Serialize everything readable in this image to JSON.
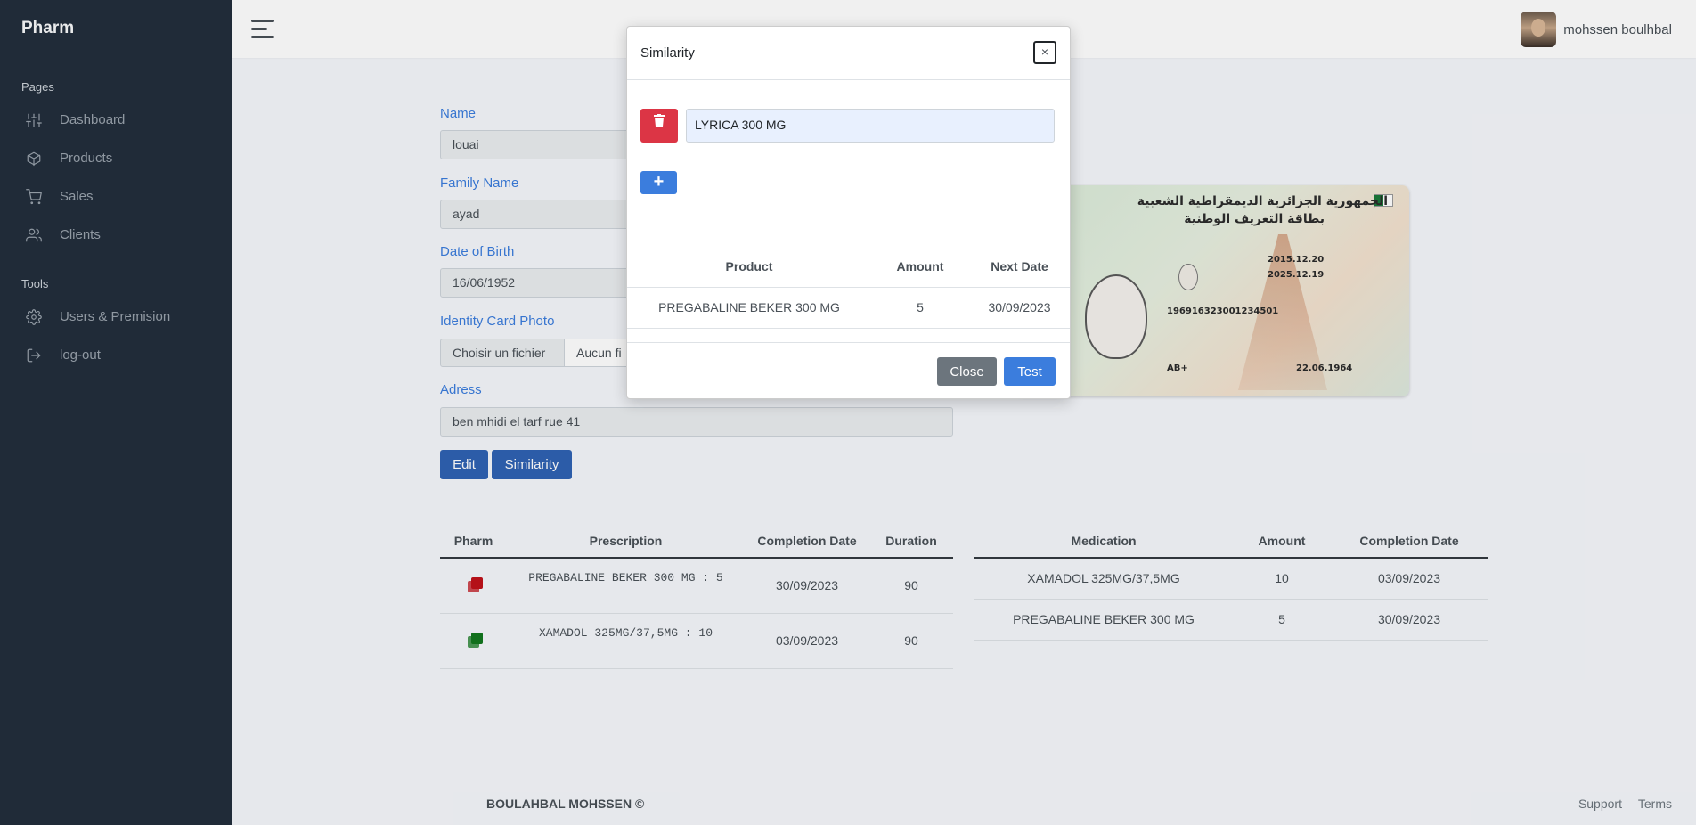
{
  "app": {
    "brand": "Pharm"
  },
  "sidebar": {
    "sections": [
      {
        "header": "Pages",
        "items": [
          {
            "label": "Dashboard",
            "icon": "sliders-icon"
          },
          {
            "label": "Products",
            "icon": "package-icon"
          },
          {
            "label": "Sales",
            "icon": "cart-icon"
          },
          {
            "label": "Clients",
            "icon": "users-icon"
          }
        ]
      },
      {
        "header": "Tools",
        "items": [
          {
            "label": "Users & Premision",
            "icon": "gear-icon"
          },
          {
            "label": "log-out",
            "icon": "logout-icon"
          }
        ]
      }
    ]
  },
  "topbar": {
    "user_name": "mohssen boulhbal"
  },
  "form": {
    "name_label": "Name",
    "name_value": "louai",
    "family_label": "Family Name",
    "family_value": "ayad",
    "dob_label": "Date of Birth",
    "dob_value": "16/06/1952",
    "photo_label": "Identity Card Photo",
    "file_button": "Choisir un fichier",
    "file_name": "Aucun fi",
    "address_label": "Adress",
    "address_value": "ben mhidi el tarf rue 41",
    "edit_button": "Edit",
    "similarity_button": "Similarity"
  },
  "idcard": {
    "line1": "الجمهورية الجزائرية الديمقراطية الشعبية",
    "line2": "بطاقة التعريف الوطنية",
    "date1": "2015.12.20",
    "date2": "2025.12.19",
    "number": "196916323001234501",
    "birth": "22.06.1964",
    "blood": "AB+"
  },
  "prescriptions_table": {
    "headers": [
      "Pharm",
      "Prescription",
      "Completion Date",
      "Duration"
    ],
    "rows": [
      {
        "icon_color": "#c0111a",
        "prescription": "PREGABALINE BEKER 300 MG : 5",
        "date": "30/09/2023",
        "duration": "90"
      },
      {
        "icon_color": "#13781e",
        "prescription": "XAMADOL 325MG/37,5MG : 10",
        "date": "03/09/2023",
        "duration": "90"
      }
    ]
  },
  "medication_table": {
    "headers": [
      "Medication",
      "Amount",
      "Completion Date"
    ],
    "rows": [
      {
        "medication": "XAMADOL 325MG/37,5MG",
        "amount": "10",
        "date": "03/09/2023"
      },
      {
        "medication": "PREGABALINE BEKER 300 MG",
        "amount": "5",
        "date": "30/09/2023"
      }
    ]
  },
  "footer": {
    "copyright": "BOULAHBAL MOHSSEN ©",
    "support": "Support",
    "terms": "Terms"
  },
  "modal": {
    "title": "Similarity",
    "close_x": "×",
    "input_value": "LYRICA 300 MG",
    "plus": "+",
    "table": {
      "headers": [
        "Product",
        "Amount",
        "Next Date"
      ],
      "rows": [
        {
          "product": "PREGABALINE BEKER 300 MG",
          "amount": "5",
          "next_date": "30/09/2023"
        }
      ]
    },
    "close_button": "Close",
    "test_button": "Test"
  },
  "colors": {
    "sidebar_bg": "#222e3c",
    "primary": "#3b7ddd",
    "danger": "#dc3545",
    "secondary": "#6c757d"
  }
}
